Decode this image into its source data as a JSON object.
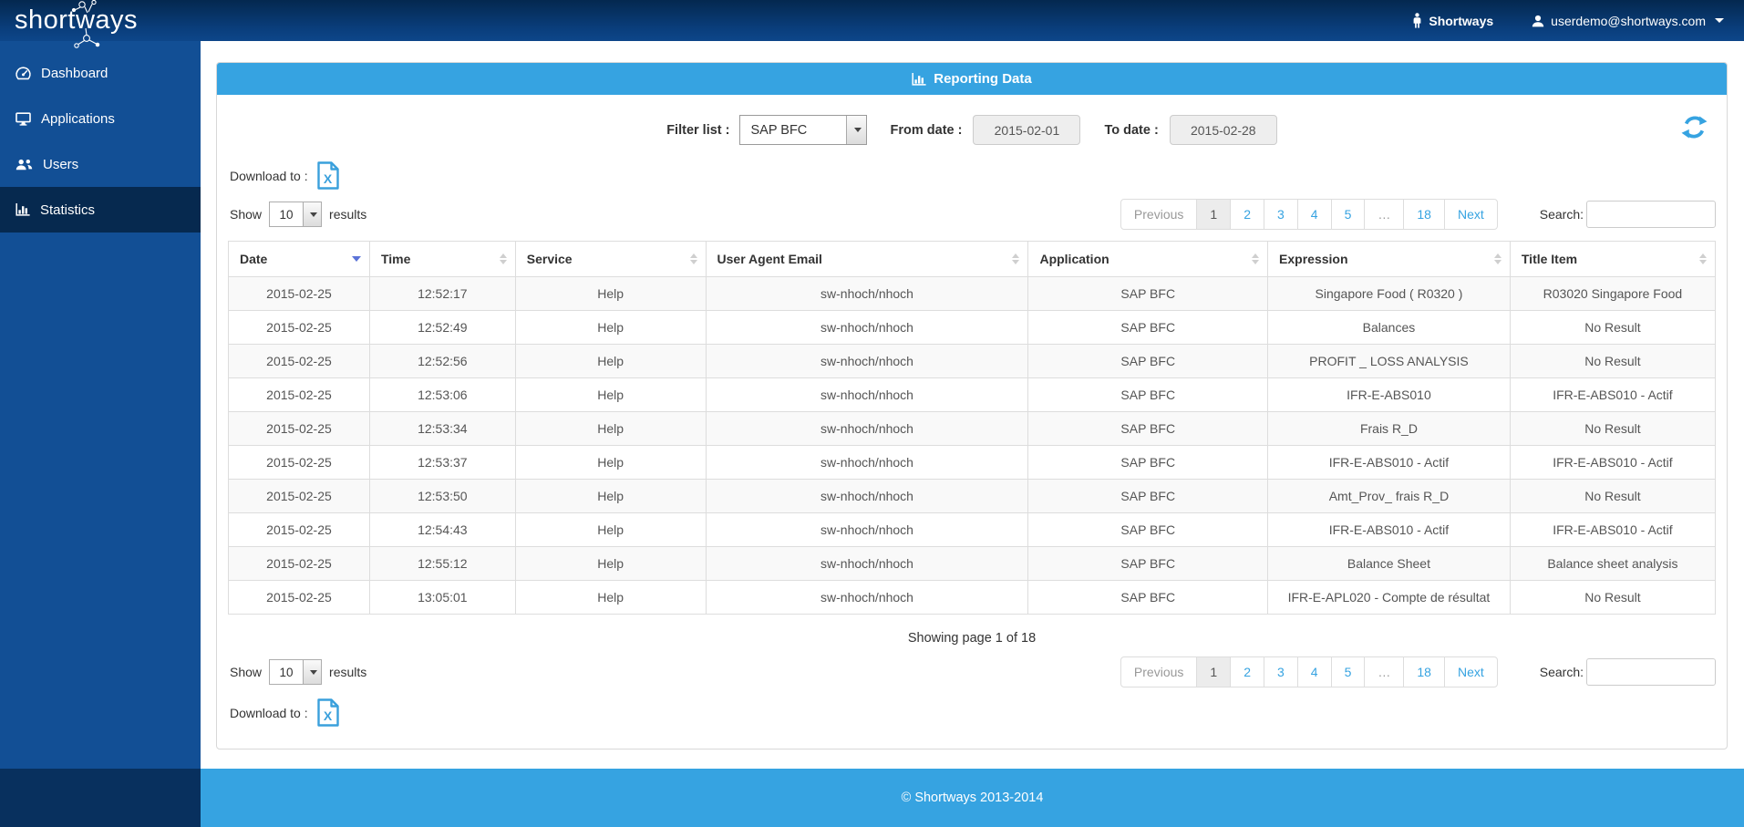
{
  "navbar": {
    "logo": "shortways",
    "product_label": "Shortways",
    "user_email": "userdemo@shortways.com"
  },
  "sidebar": {
    "items": [
      {
        "id": "dashboard",
        "label": "Dashboard",
        "active": false
      },
      {
        "id": "applications",
        "label": "Applications",
        "active": false
      },
      {
        "id": "users",
        "label": "Users",
        "active": false
      },
      {
        "id": "statistics",
        "label": "Statistics",
        "active": true
      }
    ]
  },
  "panel": {
    "title": "Reporting Data"
  },
  "filters": {
    "filter_list_label": "Filter list :",
    "filter_list_value": "SAP BFC",
    "from_date_label": "From date :",
    "from_date_value": "2015-02-01",
    "to_date_label": "To date :",
    "to_date_value": "2015-02-28"
  },
  "download": {
    "label": "Download to :"
  },
  "results_per_page": {
    "label_before": "Show",
    "value": "10",
    "label_after": "results"
  },
  "pagination": {
    "previous_label": "Previous",
    "pages": [
      "1",
      "2",
      "3",
      "4",
      "5",
      "…",
      "18"
    ],
    "active_page": "1",
    "next_label": "Next"
  },
  "search": {
    "label": "Search:",
    "value": ""
  },
  "table": {
    "columns": [
      {
        "label": "Date",
        "sort": "desc"
      },
      {
        "label": "Time",
        "sort": "both"
      },
      {
        "label": "Service",
        "sort": "both"
      },
      {
        "label": "User Agent Email",
        "sort": "both"
      },
      {
        "label": "Application",
        "sort": "both"
      },
      {
        "label": "Expression",
        "sort": "both"
      },
      {
        "label": "Title Item",
        "sort": "both"
      }
    ],
    "rows": [
      [
        "2015-02-25",
        "12:52:17",
        "Help",
        "sw-nhoch/nhoch",
        "SAP BFC",
        "Singapore Food ( R0320 )",
        "R03020 Singapore Food"
      ],
      [
        "2015-02-25",
        "12:52:49",
        "Help",
        "sw-nhoch/nhoch",
        "SAP BFC",
        "Balances",
        "No Result"
      ],
      [
        "2015-02-25",
        "12:52:56",
        "Help",
        "sw-nhoch/nhoch",
        "SAP BFC",
        "PROFIT _ LOSS ANALYSIS",
        "No Result"
      ],
      [
        "2015-02-25",
        "12:53:06",
        "Help",
        "sw-nhoch/nhoch",
        "SAP BFC",
        "IFR-E-ABS010",
        "IFR-E-ABS010 - Actif"
      ],
      [
        "2015-02-25",
        "12:53:34",
        "Help",
        "sw-nhoch/nhoch",
        "SAP BFC",
        "Frais R_D",
        "No Result"
      ],
      [
        "2015-02-25",
        "12:53:37",
        "Help",
        "sw-nhoch/nhoch",
        "SAP BFC",
        "IFR-E-ABS010 - Actif",
        "IFR-E-ABS010 - Actif"
      ],
      [
        "2015-02-25",
        "12:53:50",
        "Help",
        "sw-nhoch/nhoch",
        "SAP BFC",
        "Amt_Prov_ frais R_D",
        "No Result"
      ],
      [
        "2015-02-25",
        "12:54:43",
        "Help",
        "sw-nhoch/nhoch",
        "SAP BFC",
        "IFR-E-ABS010 - Actif",
        "IFR-E-ABS010 - Actif"
      ],
      [
        "2015-02-25",
        "12:55:12",
        "Help",
        "sw-nhoch/nhoch",
        "SAP BFC",
        "Balance Sheet",
        "Balance sheet analysis"
      ],
      [
        "2015-02-25",
        "13:05:01",
        "Help",
        "sw-nhoch/nhoch",
        "SAP BFC",
        "IFR-E-APL020 - Compte de résultat",
        "No Result"
      ]
    ]
  },
  "summary": "Showing page 1 of 18",
  "footer": {
    "copyright": "© Shortways 2013-2014"
  },
  "colors": {
    "accent": "#36a3e1",
    "navbar": "#0a3e7c",
    "sidebar": "#124f95",
    "sidebar_active": "#06294f"
  }
}
